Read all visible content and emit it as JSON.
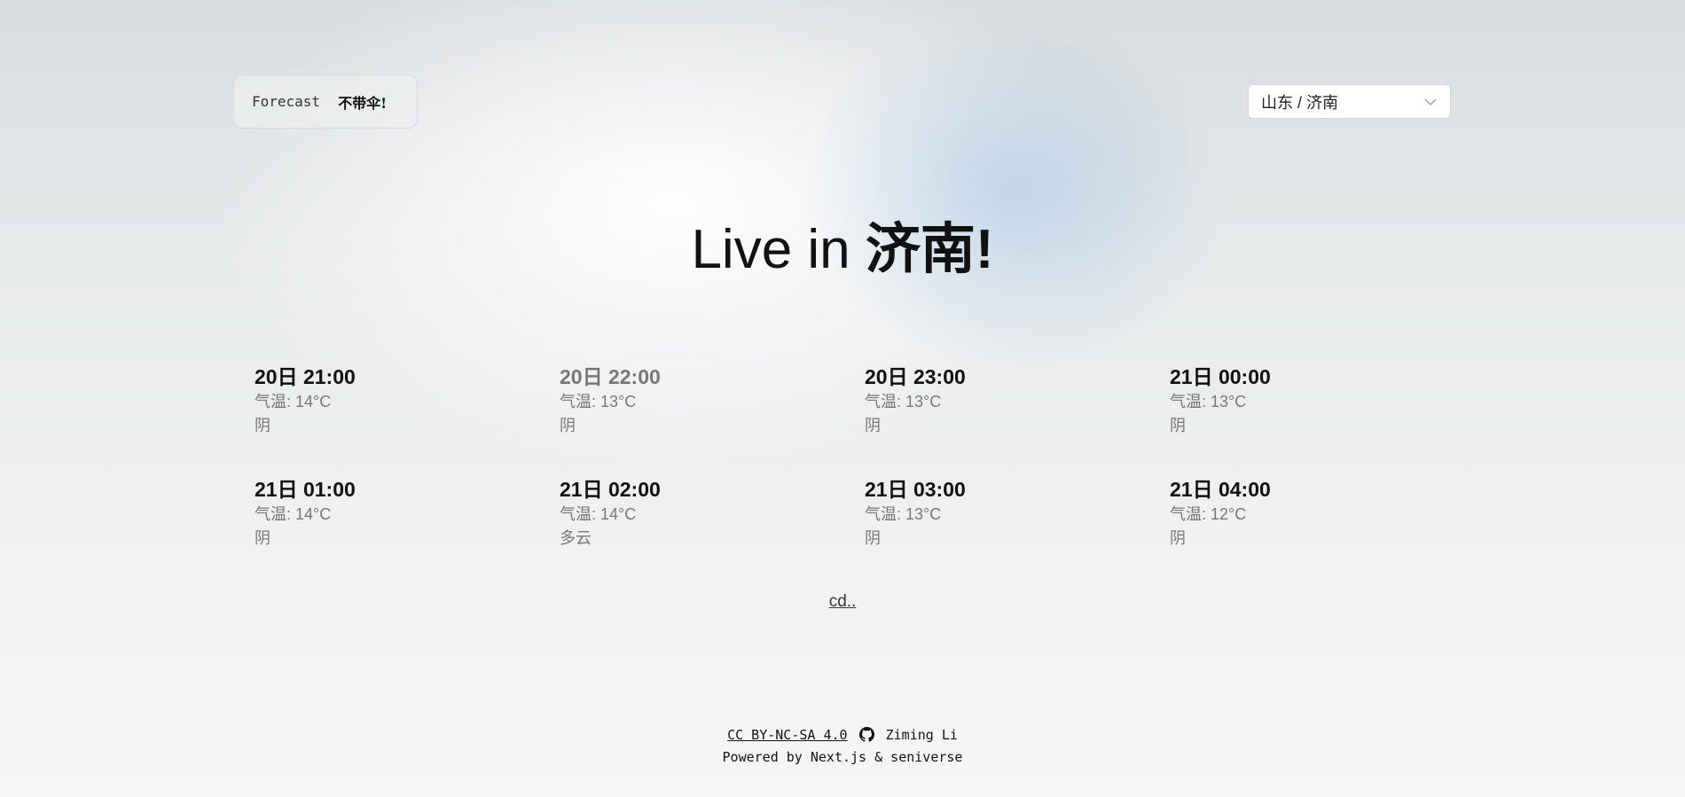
{
  "brand": {
    "label": "Forecast",
    "tagline": "不带伞!"
  },
  "location_select": {
    "value": "山东 / 济南",
    "icon": "chevron-down-icon"
  },
  "headline": {
    "prefix": "Live in ",
    "city": "济南!"
  },
  "forecast": [
    {
      "time": "20日 21:00",
      "temp": "气温: 14°C",
      "condition": "阴"
    },
    {
      "time": "20日 22:00",
      "temp": "气温: 13°C",
      "condition": "阴"
    },
    {
      "time": "20日 23:00",
      "temp": "气温: 13°C",
      "condition": "阴"
    },
    {
      "time": "21日 00:00",
      "temp": "气温: 13°C",
      "condition": "阴"
    },
    {
      "time": "21日 01:00",
      "temp": "气温: 14°C",
      "condition": "阴"
    },
    {
      "time": "21日 02:00",
      "temp": "气温: 14°C",
      "condition": "多云"
    },
    {
      "time": "21日 03:00",
      "temp": "气温: 13°C",
      "condition": "阴"
    },
    {
      "time": "21日 04:00",
      "temp": "气温: 12°C",
      "condition": "阴"
    }
  ],
  "more_link": "cd..",
  "footer": {
    "license": "CC BY-NC-SA 4.0",
    "author": "Ziming Li",
    "powered_by": "Powered by Next.js & seniverse"
  }
}
